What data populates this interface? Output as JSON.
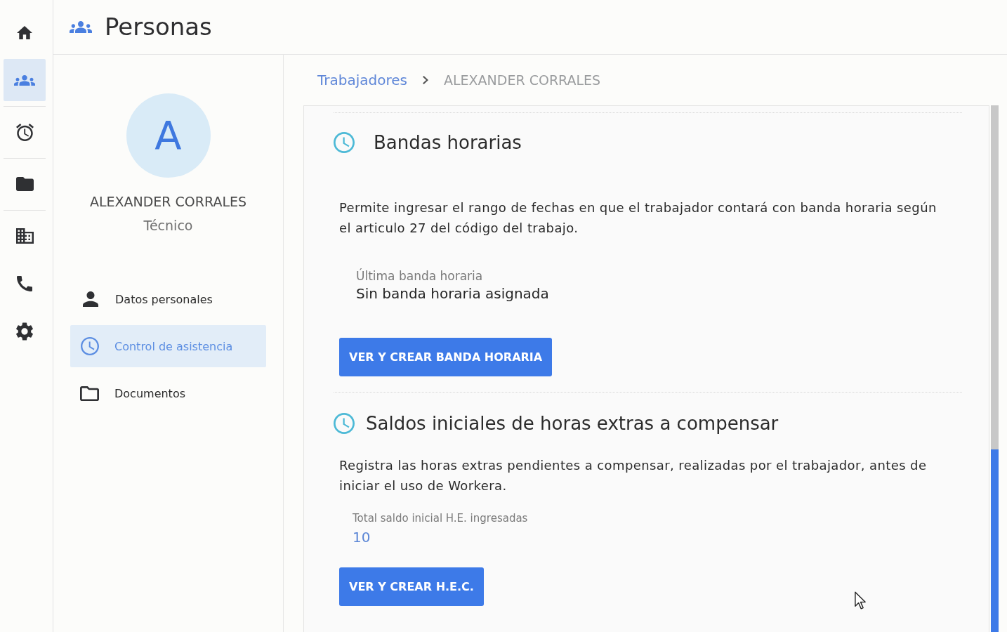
{
  "rail": {
    "groups": [
      {
        "items": [
          {
            "kind": "home",
            "selected": false
          },
          {
            "kind": "people",
            "selected": true
          }
        ]
      },
      {
        "items": [
          {
            "kind": "alarm",
            "selected": false
          }
        ]
      },
      {
        "items": [
          {
            "kind": "folder",
            "selected": false
          }
        ]
      },
      {
        "items": [
          {
            "kind": "building",
            "selected": false
          },
          {
            "kind": "phone",
            "selected": false
          },
          {
            "kind": "gear",
            "selected": false
          }
        ]
      }
    ]
  },
  "header": {
    "title": "Personas"
  },
  "profile": {
    "initial": "A",
    "name": "ALEXANDER CORRALES",
    "role": "Técnico"
  },
  "menu": [
    {
      "kind": "person",
      "label": "Datos personales",
      "selected": false
    },
    {
      "kind": "clock",
      "label": "Control de asistencia",
      "selected": true
    },
    {
      "kind": "folder",
      "label": "Documentos",
      "selected": false
    }
  ],
  "breadcrumb": [
    {
      "label": "Trabajadores",
      "current": false
    },
    {
      "label": "ALEXANDER CORRALES",
      "current": true
    }
  ],
  "sections": [
    {
      "title": "Bandas horarias",
      "description": "Permite ingresar el rango de fechas en que el trabajador contará con banda horaria según el articulo 27 del código del trabajo.",
      "field": {
        "kind": "text",
        "label": "Última banda horaria",
        "value": "Sin banda horaria asignada"
      },
      "button": "VER Y CREAR BANDA HORARIA"
    },
    {
      "title": "Saldos iniciales de horas extras a compensar",
      "description": "Registra las horas extras pendientes a compensar, realizadas por el trabajador, antes de iniciar el uso de Workera.",
      "field": {
        "kind": "number",
        "label": "Total saldo inicial H.E. ingresadas",
        "value": "10"
      },
      "button": "VER Y CREAR H.E.C."
    }
  ]
}
